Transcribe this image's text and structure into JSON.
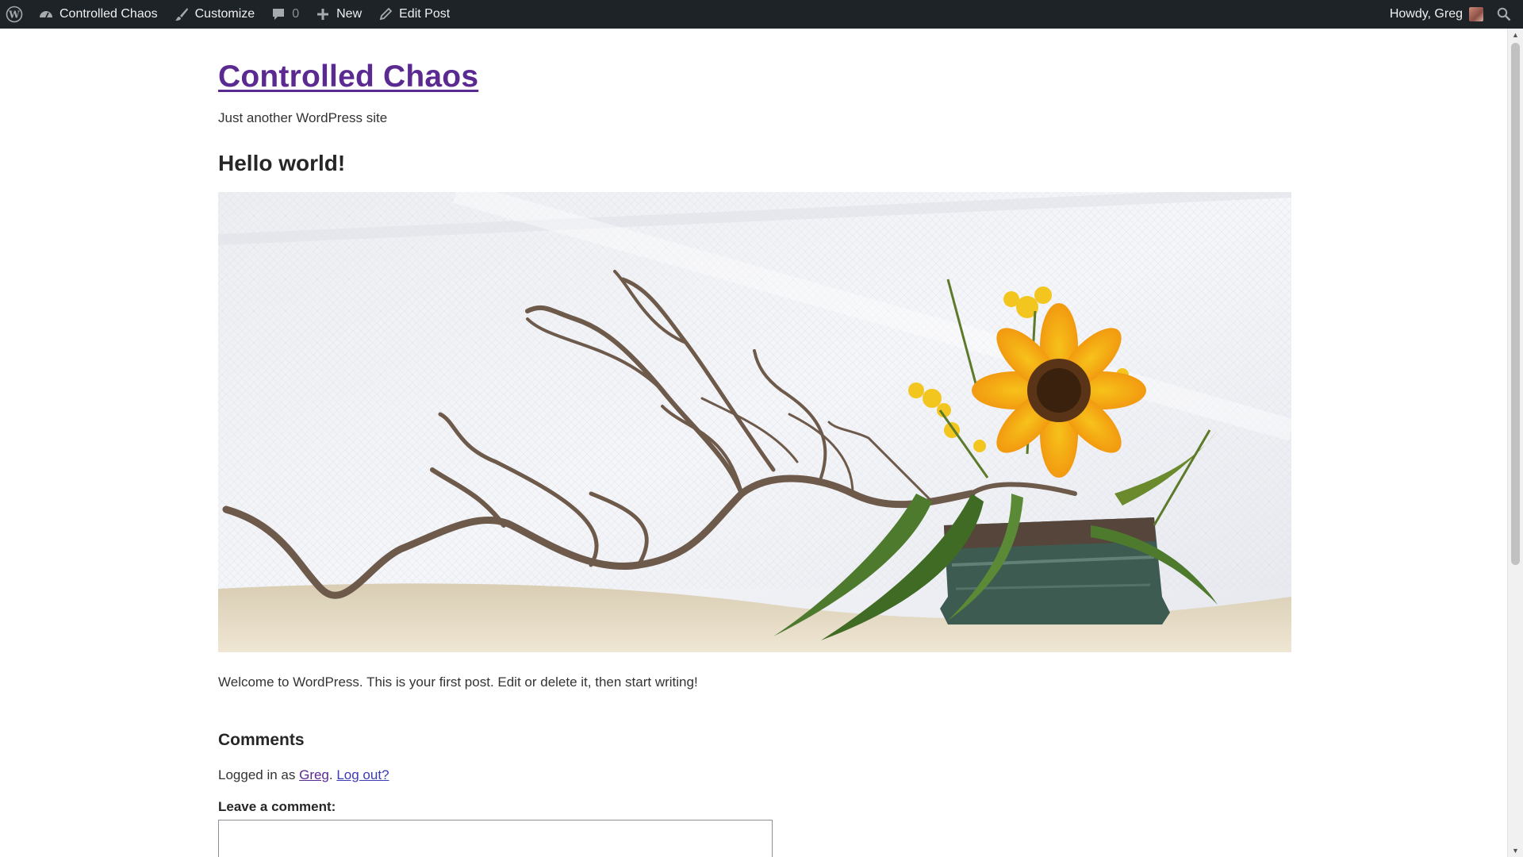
{
  "admin_bar": {
    "items": [
      {
        "label": "Controlled Chaos",
        "icon": "dashboard-icon"
      },
      {
        "label": "Customize",
        "icon": "paintbrush-icon"
      },
      {
        "label": "0",
        "icon": "comment-bubble-icon"
      },
      {
        "label": "New",
        "icon": "plus-icon"
      },
      {
        "label": "Edit Post",
        "icon": "pencil-icon"
      }
    ],
    "greeting": "Howdy, Greg"
  },
  "site": {
    "title": "Controlled Chaos",
    "tagline": "Just another WordPress site"
  },
  "post": {
    "title": "Hello world!",
    "image_description": "ikebana arrangement with curly willow branches and a sunflower",
    "content": "Welcome to WordPress. This is your first post. Edit or delete it, then start writing!"
  },
  "comments": {
    "heading": "Comments",
    "logged_in_prefix": "Logged in as ",
    "user": "Greg",
    "separator": ". ",
    "logout": "Log out?",
    "leave_label": "Leave a comment:"
  },
  "colors": {
    "admin_bar_bg": "#1d2327",
    "site_title": "#5b2a91",
    "link": "#3b3bb3"
  }
}
